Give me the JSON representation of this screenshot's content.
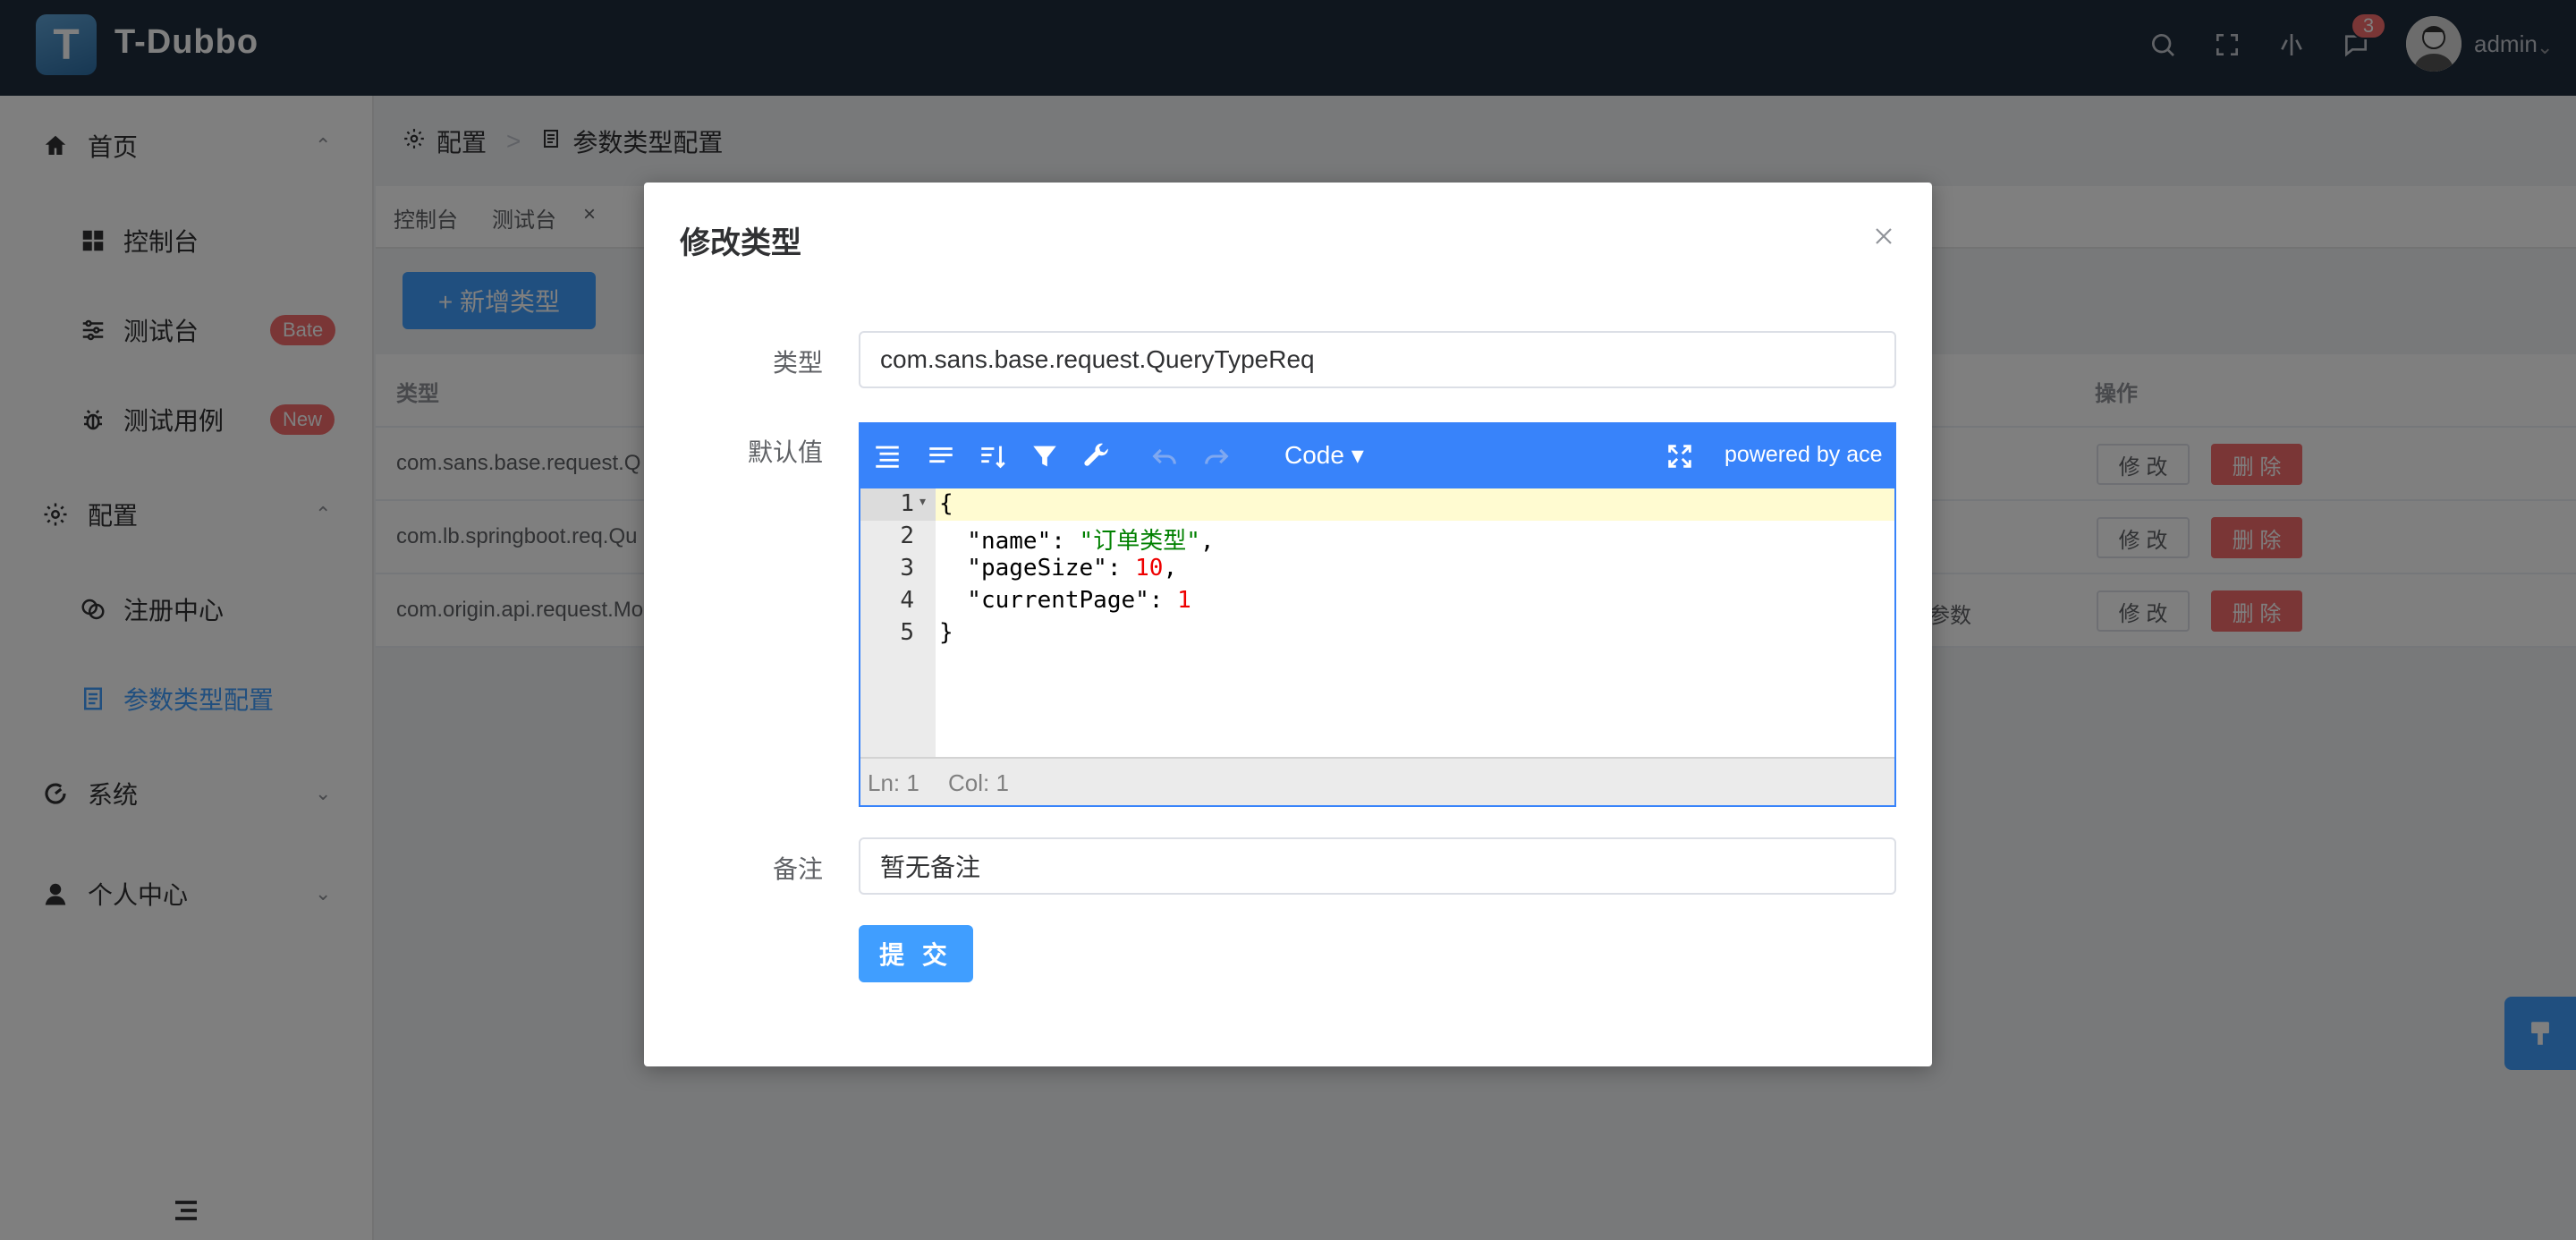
{
  "app": {
    "logo_letter": "T",
    "name": "T-Dubbo"
  },
  "header": {
    "notification_count": "3",
    "user_name": "admin"
  },
  "sidebar": {
    "items": [
      {
        "label": "首页",
        "caret": "⌃"
      },
      {
        "label": "控制台"
      },
      {
        "label": "测试台",
        "tag": "Bate"
      },
      {
        "label": "测试用例",
        "tag": "New"
      },
      {
        "label": "配置",
        "caret": "⌃"
      },
      {
        "label": "注册中心"
      },
      {
        "label": "参数类型配置"
      },
      {
        "label": "系统",
        "caret": "⌄"
      },
      {
        "label": "个人中心",
        "caret": "⌄"
      }
    ]
  },
  "breadcrumb": {
    "first": "配置",
    "separator": ">",
    "current": "参数类型配置"
  },
  "tabs": [
    {
      "label": "控制台"
    },
    {
      "label": "测试台"
    }
  ],
  "toolbar": {
    "add_label": "+ 新增类型"
  },
  "table": {
    "headers": {
      "type": "类型",
      "actions": "操作"
    },
    "rows": [
      {
        "type": "com.sans.base.request.Q",
        "remark": ""
      },
      {
        "type": "com.lb.springboot.req.Qu",
        "remark": ""
      },
      {
        "type": "com.origin.api.request.Mo",
        "remark": "参数"
      }
    ],
    "edit_label": "修 改",
    "delete_label": "删 除"
  },
  "dialog": {
    "title": "修改类型",
    "type_label": "类型",
    "type_value": "com.sans.base.request.QueryTypeReq",
    "default_label": "默认值",
    "remark_label": "备注",
    "remark_value": "暂无备注",
    "submit_label": "提 交",
    "editor": {
      "mode": "Code ▾",
      "powered": "powered by ace",
      "line_numbers": [
        "1",
        "2",
        "3",
        "4",
        "5"
      ],
      "status_ln": "Ln: 1",
      "status_col": "Col: 1"
    }
  },
  "colors": {
    "primary": "#409eff",
    "danger": "#f56c6c",
    "header_bg": "#1f2d3d",
    "ace_toolbar": "#3883fa"
  }
}
